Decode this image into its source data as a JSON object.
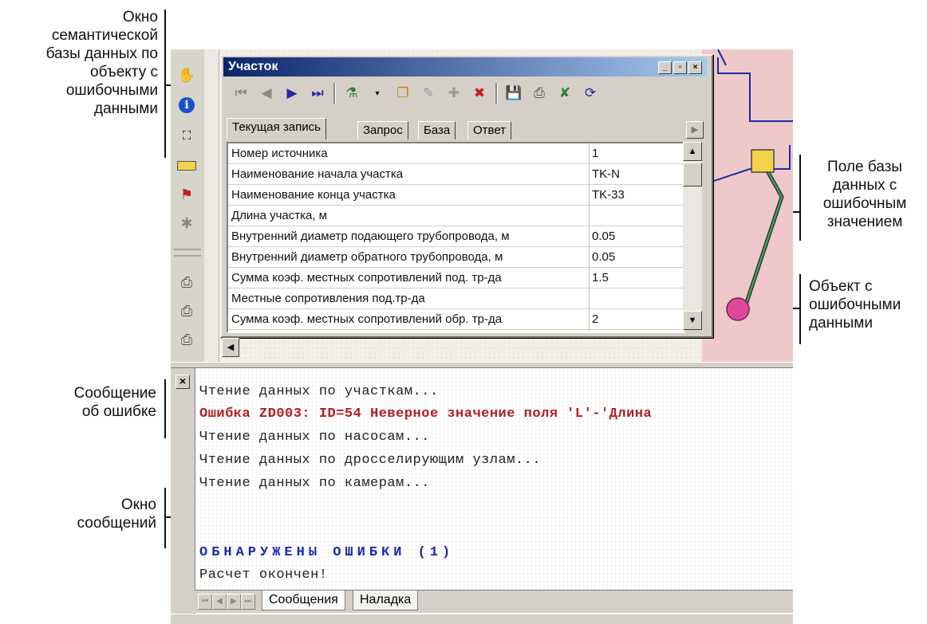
{
  "annotations": {
    "db_window": [
      "Окно",
      "семантической",
      "базы данных по",
      "объекту с",
      "ошибочными",
      "данными"
    ],
    "field": [
      "Поле базы",
      "данных с",
      "ошибочным",
      "значением"
    ],
    "object": [
      "Объект с",
      "ошибочными",
      "данными"
    ],
    "error_msg": [
      "Сообщение",
      "об ошибке"
    ],
    "msg_window": [
      "Окно",
      "сообщений"
    ]
  },
  "window": {
    "title": "Участок",
    "controls": [
      "_",
      "▫",
      "×"
    ]
  },
  "tabs": [
    "Текущая запись",
    "Запрос",
    "База",
    "Ответ"
  ],
  "grid": {
    "rows": [
      {
        "label": "Номер источника",
        "value": "1"
      },
      {
        "label": "Наименование начала участка",
        "value": "TK-N"
      },
      {
        "label": "Наименование конца участка",
        "value": "TK-33"
      },
      {
        "label": "Длина участка, м",
        "value": ""
      },
      {
        "label": "Внутренний диаметр подающего трубопровода, м",
        "value": "0.05"
      },
      {
        "label": "Внутренний диаметр обратного трубопровода, м",
        "value": "0.05"
      },
      {
        "label": "Сумма коэф. местных сопротивлений под. тр-да",
        "value": "1.5"
      },
      {
        "label": "Местные сопротивления под.тр-да",
        "value": ""
      },
      {
        "label": "Сумма коэф. местных сопротивлений обр. тр-да",
        "value": "2"
      }
    ]
  },
  "messages": {
    "lines": [
      "Чтение данных по участкам...",
      "Ошибка ZD003: ID=54 Неверное значение поля 'L'-'Длина",
      "Чтение данных по насосам...",
      "Чтение данных по дросселирующим узлам...",
      "Чтение данных по камерам...",
      "ОБНАРУЖЕНЫ ОШИБКИ (1)",
      "Расчет окончен!"
    ]
  },
  "bottom_tabs": [
    "Сообщения",
    "Наладка"
  ],
  "colors": {
    "title_bar": "#0a246a",
    "error_text": "#b11e1e",
    "found_text": "#1d2aa8",
    "map_zone": "#efc9c9",
    "pipe_node": "#f2d34a",
    "error_object": "#e0499a"
  }
}
